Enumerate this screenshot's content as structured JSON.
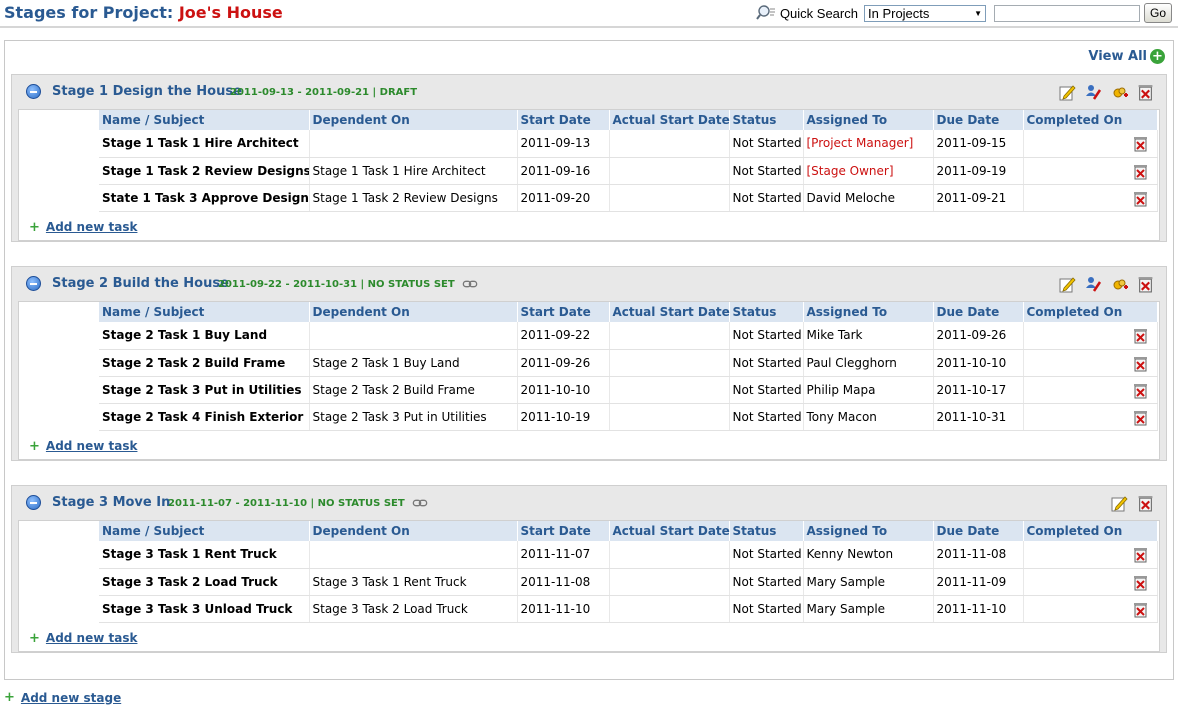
{
  "header": {
    "title_prefix": "Stages for Project:",
    "project_name": "Joe's House",
    "quick_search_label": "Quick Search",
    "scope_selected": "In Projects",
    "search_value": "",
    "go_label": "Go"
  },
  "view_all_label": "View All",
  "columns": [
    "Name / Subject",
    "Dependent On",
    "Start Date",
    "Actual Start Date",
    "Status",
    "Assigned To",
    "Due Date",
    "Completed On"
  ],
  "add_task_label": "Add new task",
  "add_stage_label": "Add new stage",
  "stages": [
    {
      "name": "Stage 1 Design the House",
      "meta": "2011-09-13 - 2011-09-21 | DRAFT",
      "tasks": [
        {
          "name": "Stage 1 Task 1 Hire Architect",
          "dependent": "",
          "start": "2011-09-13",
          "actual": "",
          "status": "Not Started",
          "assigned": "[Project Manager]",
          "due": "2011-09-15",
          "completed": ""
        },
        {
          "name": "Stage 1 Task 2 Review Designs",
          "dependent": "Stage 1 Task 1 Hire Architect",
          "start": "2011-09-16",
          "actual": "",
          "status": "Not Started",
          "assigned": "[Stage Owner]",
          "due": "2011-09-19",
          "completed": ""
        },
        {
          "name": "State 1 Task 3 Approve Design",
          "dependent": "Stage 1 Task 2 Review Designs",
          "start": "2011-09-20",
          "actual": "",
          "status": "Not Started",
          "assigned": "David Meloche",
          "due": "2011-09-21",
          "completed": ""
        }
      ]
    },
    {
      "name": "Stage 2 Build the House",
      "meta": "2011-09-22 - 2011-10-31 | NO STATUS SET",
      "tasks": [
        {
          "name": "Stage 2 Task 1 Buy Land",
          "dependent": "",
          "start": "2011-09-22",
          "actual": "",
          "status": "Not Started",
          "assigned": "Mike Tark",
          "due": "2011-09-26",
          "completed": ""
        },
        {
          "name": "Stage 2 Task 2 Build Frame",
          "dependent": "Stage 2 Task 1 Buy Land",
          "start": "2011-09-26",
          "actual": "",
          "status": "Not Started",
          "assigned": "Paul Clegghorn",
          "due": "2011-10-10",
          "completed": ""
        },
        {
          "name": "Stage 2 Task 3 Put in Utilities",
          "dependent": "Stage 2 Task 2 Build Frame",
          "start": "2011-10-10",
          "actual": "",
          "status": "Not Started",
          "assigned": "Philip Mapa",
          "due": "2011-10-17",
          "completed": ""
        },
        {
          "name": "Stage 2 Task 4 Finish Exterior",
          "dependent": "Stage 2 Task 3 Put in Utilities",
          "start": "2011-10-19",
          "actual": "",
          "status": "Not Started",
          "assigned": "Tony Macon",
          "due": "2011-10-31",
          "completed": ""
        }
      ]
    },
    {
      "name": "Stage 3 Move In",
      "meta": "2011-11-07 - 2011-11-10 | NO STATUS SET",
      "tasks": [
        {
          "name": "Stage 3 Task 1 Rent Truck",
          "dependent": "",
          "start": "2011-11-07",
          "actual": "",
          "status": "Not Started",
          "assigned": "Kenny Newton",
          "due": "2011-11-08",
          "completed": ""
        },
        {
          "name": "Stage 3 Task 2 Load Truck",
          "dependent": "Stage 3 Task 1 Rent Truck",
          "start": "2011-11-08",
          "actual": "",
          "status": "Not Started",
          "assigned": "Mary Sample",
          "due": "2011-11-09",
          "completed": ""
        },
        {
          "name": "Stage 3 Task 3 Unload Truck",
          "dependent": "Stage 3 Task 2 Load Truck",
          "start": "2011-11-10",
          "actual": "",
          "status": "Not Started",
          "assigned": "Mary Sample",
          "due": "2011-11-10",
          "completed": ""
        }
      ]
    }
  ],
  "colors": {
    "brand_blue": "#2a5a92",
    "project_red": "#cc1111",
    "meta_green": "#2c8a2c"
  }
}
